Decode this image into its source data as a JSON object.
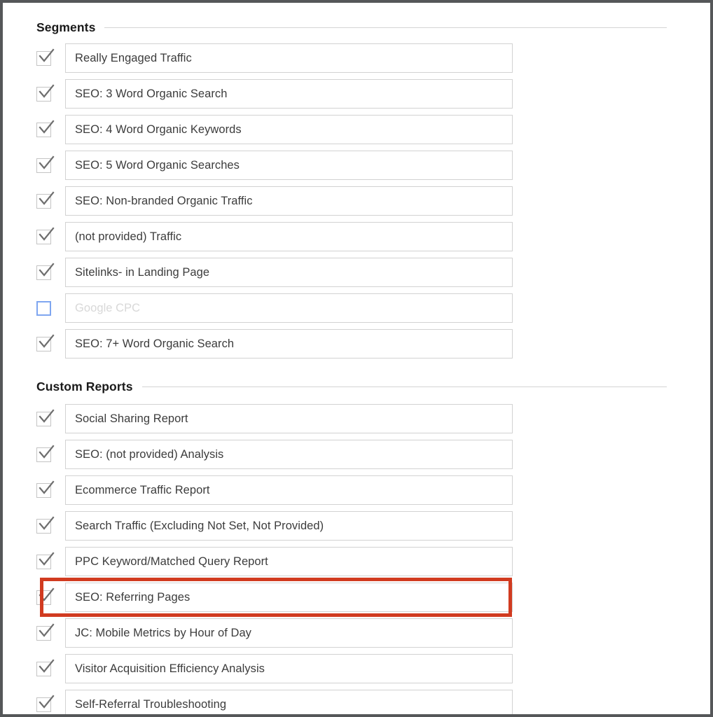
{
  "colors": {
    "frame": "#555759",
    "heading_text": "#1a1a1a",
    "field_border": "#d2d2d2",
    "field_text": "#3c3c3c",
    "placeholder_text": "#d8d8d8",
    "checkbox_border": "#c4c4c4",
    "checkbox_unchecked_border": "#7fa6f0",
    "highlight": "#d13b20",
    "rule": "#d4d4d4"
  },
  "sections": [
    {
      "id": "segments",
      "title": "Segments",
      "items": [
        {
          "label": "Really Engaged Traffic",
          "checked": true,
          "placeholder": false,
          "highlighted": false
        },
        {
          "label": "SEO: 3 Word Organic Search",
          "checked": true,
          "placeholder": false,
          "highlighted": false
        },
        {
          "label": "SEO: 4 Word Organic Keywords",
          "checked": true,
          "placeholder": false,
          "highlighted": false
        },
        {
          "label": "SEO: 5 Word Organic Searches",
          "checked": true,
          "placeholder": false,
          "highlighted": false
        },
        {
          "label": "SEO: Non-branded Organic Traffic",
          "checked": true,
          "placeholder": false,
          "highlighted": false
        },
        {
          "label": "(not provided) Traffic",
          "checked": true,
          "placeholder": false,
          "highlighted": false
        },
        {
          "label": "Sitelinks- in Landing Page",
          "checked": true,
          "placeholder": false,
          "highlighted": false
        },
        {
          "label": "Google CPC",
          "checked": false,
          "placeholder": true,
          "highlighted": false
        },
        {
          "label": "SEO: 7+ Word Organic Search",
          "checked": true,
          "placeholder": false,
          "highlighted": false
        }
      ]
    },
    {
      "id": "custom-reports",
      "title": "Custom Reports",
      "items": [
        {
          "label": "Social Sharing Report",
          "checked": true,
          "placeholder": false,
          "highlighted": false
        },
        {
          "label": "SEO: (not provided) Analysis",
          "checked": true,
          "placeholder": false,
          "highlighted": false
        },
        {
          "label": "Ecommerce Traffic Report",
          "checked": true,
          "placeholder": false,
          "highlighted": false
        },
        {
          "label": "Search Traffic (Excluding Not Set, Not Provided)",
          "checked": true,
          "placeholder": false,
          "highlighted": false
        },
        {
          "label": "PPC Keyword/Matched Query Report",
          "checked": true,
          "placeholder": false,
          "highlighted": false
        },
        {
          "label": "SEO: Referring Pages",
          "checked": true,
          "placeholder": false,
          "highlighted": true
        },
        {
          "label": "JC: Mobile Metrics by Hour of Day",
          "checked": true,
          "placeholder": false,
          "highlighted": false
        },
        {
          "label": "Visitor Acquisition Efficiency Analysis",
          "checked": true,
          "placeholder": false,
          "highlighted": false
        },
        {
          "label": "Self-Referral Troubleshooting",
          "checked": true,
          "placeholder": false,
          "highlighted": false
        }
      ]
    }
  ],
  "icons": {
    "checkmark": "check-icon",
    "empty_checkbox": "checkbox-empty-icon"
  }
}
